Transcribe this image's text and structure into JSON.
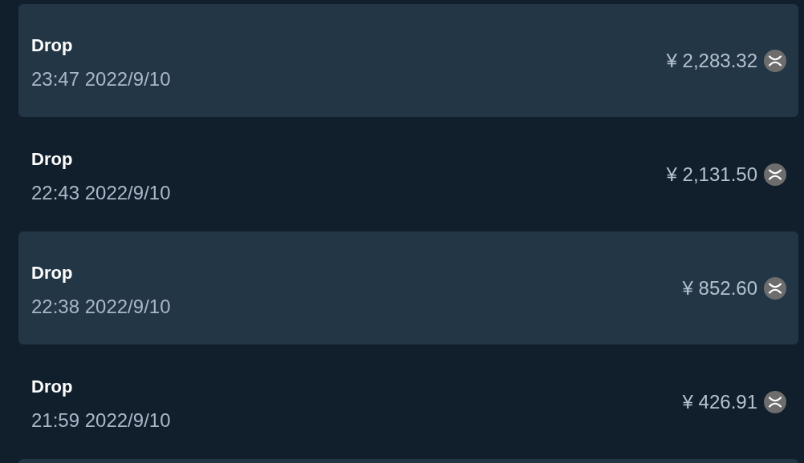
{
  "transactions": [
    {
      "shaded": true,
      "title": "Drop",
      "time": "23:47 2022/9/10",
      "amount": "¥ 2,283.32"
    },
    {
      "shaded": false,
      "title": "Drop",
      "time": "22:43 2022/9/10",
      "amount": "¥ 2,131.50"
    },
    {
      "shaded": true,
      "title": "Drop",
      "time": "22:38 2022/9/10",
      "amount": "¥ 852.60"
    },
    {
      "shaded": false,
      "title": "Drop",
      "time": "21:59 2022/9/10",
      "amount": "¥ 426.91"
    },
    {
      "shaded": true
    }
  ]
}
